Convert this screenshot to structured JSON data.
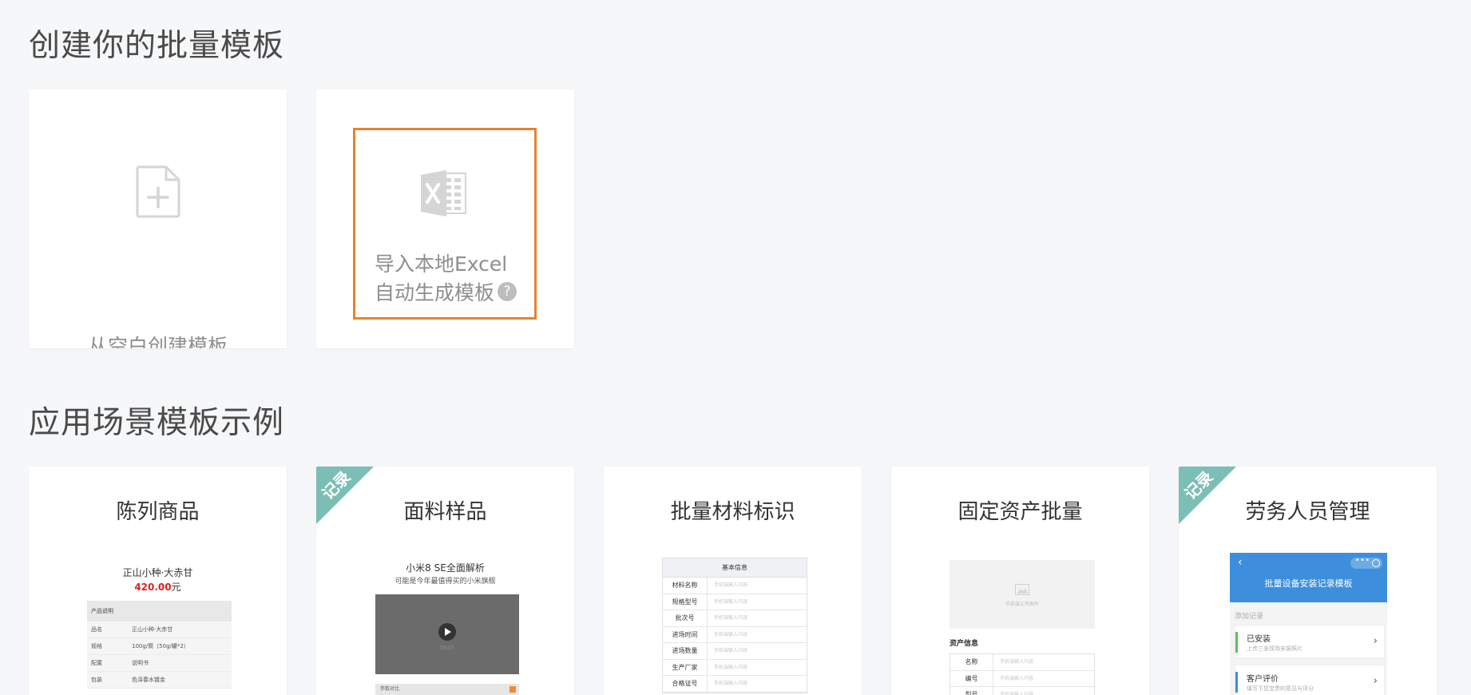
{
  "section1": {
    "title": "创建你的批量模板"
  },
  "create_cards": {
    "blank": {
      "label": "从空白创建模板",
      "icon": "file-add-icon"
    },
    "excel": {
      "line1": "导入本地Excel",
      "line2": "自动生成模板",
      "help": "?",
      "icon": "excel-icon"
    }
  },
  "section2": {
    "title": "应用场景模板示例"
  },
  "scenes": [
    {
      "title": "陈列商品",
      "preview": {
        "product": "正山小种·大赤甘",
        "price": "420.00",
        "price_unit": "元",
        "table_head": "产品说明",
        "rows": [
          {
            "k": "品名",
            "v": "正山小种·大赤甘"
          },
          {
            "k": "规格",
            "v": "100g/筒（50g/罐*2）"
          },
          {
            "k": "配置",
            "v": "说明书"
          },
          {
            "k": "包装",
            "v": "色泽春水镀金"
          }
        ]
      }
    },
    {
      "title": "面料样品",
      "ribbon": "记录",
      "preview": {
        "headline": "小米8 SE全面解析",
        "sub": "可能是今年最值得买的小米旗舰",
        "duration": "03:07",
        "bar_label": "参数对比"
      }
    },
    {
      "title": "批量材料标识",
      "preview": {
        "head": "基本信息",
        "placeholder": "手机端输入内容",
        "rows": [
          "材料名称",
          "规格型号",
          "批次号",
          "进场时间",
          "进场数量",
          "生产厂家",
          "合格证号"
        ]
      }
    },
    {
      "title": "固定资产批量",
      "preview": {
        "image_text": "手机端上传图片",
        "section": "资产信息",
        "placeholder": "手机端输入内容",
        "rows": [
          "名称",
          "编号",
          "型号"
        ]
      }
    },
    {
      "title": "劳务人员管理",
      "ribbon": "记录",
      "preview": {
        "header": "批量设备安装记录模板",
        "add": "添加记录",
        "items": [
          {
            "name": "已安装",
            "desc": "上传三张现场安装照片",
            "color": "#5cc15c"
          },
          {
            "name": "客户评价",
            "desc": "填写下您宝贵的意见与评分",
            "color": "#3d8fdd"
          }
        ]
      }
    }
  ],
  "colors": {
    "accent": "#e7822d",
    "ribbon": "#7bbeb5",
    "price": "#e02020",
    "header_blue": "#3d8fdd"
  }
}
